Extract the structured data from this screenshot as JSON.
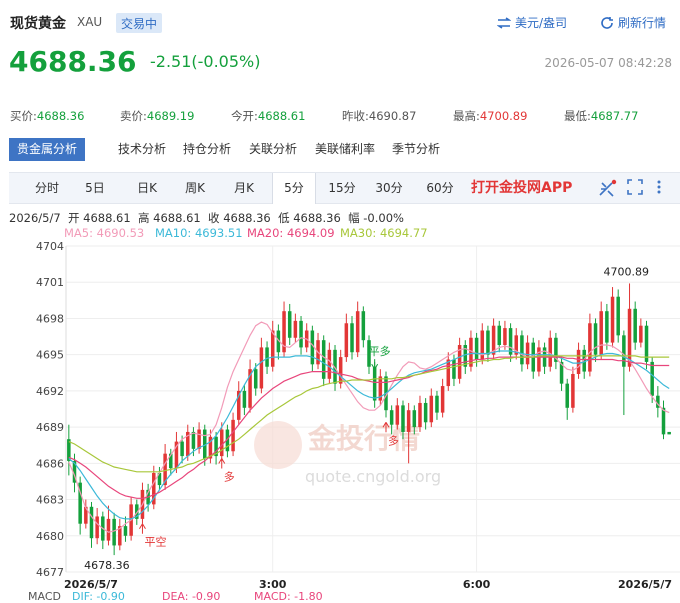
{
  "header": {
    "title": "现货黄金",
    "code": "XAU",
    "status": "交易中",
    "currency_label": "美元/盎司",
    "refresh_label": "刷新行情"
  },
  "quote": {
    "price": "4688.36",
    "change": "-2.51(-0.05%)",
    "time": "2026-05-07 08:42:28",
    "bid_label": "买价:",
    "bid": "4688.36",
    "ask_label": "卖价:",
    "ask": "4689.19",
    "open_label": "今开:",
    "open": "4688.61",
    "prev_close_label": "昨收:",
    "prev_close": "4690.87",
    "high_label": "最高:",
    "high": "4700.89",
    "low_label": "最低:",
    "low": "4687.77"
  },
  "analysis_tabs": [
    "贵金属分析",
    "技术分析",
    "持仓分析",
    "关联分析",
    "美联储利率",
    "季节分析"
  ],
  "period_tabs": [
    "分时",
    "5日",
    "日K",
    "周K",
    "月K",
    "5分",
    "15分",
    "30分",
    "60分"
  ],
  "active_period": "5分",
  "app_link": "打开金投网APP",
  "icons": {
    "currency": "swap-icon",
    "refresh": "refresh-icon",
    "draw": "draw-tool-icon",
    "fullscreen": "fullscreen-icon",
    "more": "more-icon"
  },
  "colors": {
    "up": "#e23636",
    "down": "#14a03c",
    "ma5": "#f29bb8",
    "ma10": "#3cb9d8",
    "ma20": "#e8467c",
    "ma30": "#a8c73a"
  },
  "ohlc_line": {
    "date": "2026/5/7",
    "open_label": "开",
    "open": "4688.61",
    "high_label": "高",
    "high": "4688.61",
    "close_label": "收",
    "close": "4688.36",
    "low_label": "低",
    "low": "4688.36",
    "amp_label": "幅",
    "amp": "-0.00%"
  },
  "ma_legend": [
    {
      "label": "MA5:",
      "value": "4690.53"
    },
    {
      "label": "MA10:",
      "value": "4693.51"
    },
    {
      "label": "MA20:",
      "value": "4694.09"
    },
    {
      "label": "MA30:",
      "value": "4694.77"
    }
  ],
  "macd_legend": [
    "MACD",
    "DIF: -0.90",
    "DEA: -0.90",
    "MACD: -1.80"
  ],
  "watermark": {
    "text": "金投行情",
    "url": "quote.cngold.org"
  },
  "chart_data": {
    "type": "candlestick",
    "ylim": [
      4677,
      4704
    ],
    "yticks": [
      4704,
      4701,
      4698,
      4695,
      4692,
      4689,
      4686,
      4683,
      4680,
      4677
    ],
    "xticks": [
      {
        "label": "2026/5/7",
        "index": 0
      },
      {
        "label": "3:00",
        "index": 36
      },
      {
        "label": "6:00",
        "index": 72
      },
      {
        "label": "2026/5/7",
        "index": 108
      }
    ],
    "annotations": [
      {
        "text": "4678.36",
        "type": "low"
      },
      {
        "text": "4700.89",
        "type": "high"
      },
      {
        "text": "平空",
        "type": "signal"
      },
      {
        "text": "多",
        "type": "signal"
      },
      {
        "text": "平多",
        "type": "signal"
      },
      {
        "text": "多",
        "type": "signal"
      }
    ],
    "series": [
      {
        "name": "MA5",
        "values": [
          4686.1,
          4685.0,
          4683.6,
          4682.3,
          4681.6,
          4681.0,
          4680.6,
          4680.3,
          4680.4,
          4680.6,
          4681.0,
          4681.3,
          4681.9,
          4682.6,
          4683.6,
          4684.4,
          4685.2,
          4686.0,
          4686.7,
          4687.4,
          4688.0,
          4688.3,
          4688.5,
          4688.4,
          4688.3,
          4688.4,
          4689.2,
          4690.6,
          4692.3,
          4693.6,
          4694.6,
          4695.6,
          4696.6,
          4697.4,
          4697.7,
          4697.5,
          4696.8,
          4696.2,
          4695.7,
          4695.6,
          4696.0,
          4696.4,
          4696.3,
          4695.8,
          4695.2,
          4694.8,
          4694.5,
          4693.9,
          4693.2,
          4692.5,
          4691.8,
          4691.1,
          4690.6,
          4690.4,
          4690.4,
          4690.8,
          4691.6,
          4692.5,
          4693.3,
          4694.0,
          4694.4,
          4694.3,
          4693.9,
          4693.8,
          4694.0,
          4694.3,
          4694.6,
          4694.9,
          4695.2,
          4695.4,
          4695.5,
          4695.3,
          4695.1,
          4695.0,
          4695.1,
          4695.3,
          4695.6,
          4695.7,
          4695.6,
          4695.3,
          4695.0,
          4694.8,
          4694.9,
          4695.2,
          4695.3,
          4695.1,
          4694.7,
          4694.2,
          4693.8,
          4693.7,
          4694.0,
          4694.6,
          4695.2,
          4695.6,
          4695.8,
          4695.8,
          4695.7,
          4695.4,
          4695.0,
          4694.5,
          4693.8,
          4693.0,
          4692.2,
          4691.5,
          4690.9,
          4690.4,
          4690.2
        ]
      },
      {
        "name": "MA10",
        "values": [
          4686.4,
          4686.0,
          4685.4,
          4684.7,
          4684.0,
          4683.3,
          4682.7,
          4682.2,
          4681.8,
          4681.5,
          4681.4,
          4681.4,
          4681.6,
          4682.0,
          4682.5,
          4683.1,
          4683.8,
          4684.5,
          4685.1,
          4685.6,
          4686.2,
          4686.6,
          4687.0,
          4687.3,
          4687.5,
          4687.8,
          4688.3,
          4689.0,
          4689.8,
          4690.7,
          4691.6,
          4692.5,
          4693.3,
          4694.0,
          4694.4,
          4694.7,
          4694.8,
          4694.8,
          4694.8,
          4694.8,
          4694.9,
          4694.9,
          4694.9,
          4694.8,
          4694.6,
          4694.3,
          4694.0,
          4693.6,
          4693.2,
          4692.8,
          4692.4,
          4692.0,
          4691.7,
          4691.5,
          4691.4,
          4691.5,
          4691.8,
          4692.2,
          4692.6,
          4693.0,
          4693.3,
          4693.5,
          4693.6,
          4693.7,
          4693.8,
          4694.0,
          4694.2,
          4694.4,
          4694.6,
          4694.8,
          4695.0,
          4695.1,
          4695.1,
          4695.1,
          4695.1,
          4695.2,
          4695.3,
          4695.3,
          4695.3,
          4695.2,
          4695.1,
          4695.0,
          4695.0,
          4695.0,
          4695.0,
          4695.0,
          4694.9,
          4694.7,
          4694.5,
          4694.3,
          4694.3,
          4694.4,
          4694.6,
          4694.8,
          4695.0,
          4695.1,
          4695.1,
          4695.0,
          4694.8,
          4694.6,
          4694.3,
          4694.0,
          4693.7,
          4693.3,
          4692.9,
          4692.5,
          4692.2
        ]
      },
      {
        "name": "MA20",
        "values": [
          4686.5,
          4686.3,
          4686.0,
          4685.7,
          4685.3,
          4684.9,
          4684.5,
          4684.1,
          4683.8,
          4683.5,
          4683.3,
          4683.2,
          4683.1,
          4683.1,
          4683.2,
          4683.4,
          4683.6,
          4683.9,
          4684.2,
          4684.5,
          4684.8,
          4685.2,
          4685.5,
          4685.9,
          4686.2,
          4686.6,
          4687.0,
          4687.5,
          4688.0,
          4688.6,
          4689.2,
          4689.8,
          4690.4,
          4690.9,
          4691.4,
          4691.8,
          4692.2,
          4692.5,
          4692.8,
          4693.0,
          4693.2,
          4693.4,
          4693.5,
          4693.6,
          4693.6,
          4693.6,
          4693.6,
          4693.5,
          4693.4,
          4693.3,
          4693.2,
          4693.0,
          4692.9,
          4692.8,
          4692.7,
          4692.7,
          4692.7,
          4692.8,
          4692.9,
          4693.0,
          4693.1,
          4693.3,
          4693.4,
          4693.6,
          4693.7,
          4693.8,
          4694.0,
          4694.1,
          4694.2,
          4694.3,
          4694.4,
          4694.5,
          4694.6,
          4694.6,
          4694.7,
          4694.7,
          4694.8,
          4694.8,
          4694.8,
          4694.8,
          4694.8,
          4694.8,
          4694.8,
          4694.8,
          4694.8,
          4694.8,
          4694.8,
          4694.8,
          4694.7,
          4694.7,
          4694.6,
          4694.6,
          4694.6,
          4694.6,
          4694.6,
          4694.6,
          4694.6,
          4694.5,
          4694.5,
          4694.4,
          4694.3,
          4694.3,
          4694.2,
          4694.1,
          4694.1,
          4694.1,
          4694.1
        ]
      },
      {
        "name": "MA30",
        "values": [
          4687.8,
          4687.6,
          4687.3,
          4687.0,
          4686.7,
          4686.4,
          4686.1,
          4685.9,
          4685.7,
          4685.6,
          4685.5,
          4685.4,
          4685.3,
          4685.3,
          4685.3,
          4685.3,
          4685.3,
          4685.4,
          4685.5,
          4685.6,
          4685.7,
          4685.9,
          4686.0,
          4686.2,
          4686.4,
          4686.6,
          4686.8,
          4687.1,
          4687.4,
          4687.7,
          4688.0,
          4688.4,
          4688.8,
          4689.2,
          4689.6,
          4690.0,
          4690.3,
          4690.6,
          4690.9,
          4691.2,
          4691.5,
          4691.7,
          4692.0,
          4692.2,
          4692.3,
          4692.5,
          4692.6,
          4692.7,
          4692.8,
          4692.8,
          4692.9,
          4692.9,
          4692.9,
          4692.9,
          4693.0,
          4693.0,
          4693.0,
          4693.0,
          4693.1,
          4693.1,
          4693.2,
          4693.3,
          4693.4,
          4693.5,
          4693.6,
          4693.7,
          4693.8,
          4693.9,
          4694.0,
          4694.1,
          4694.2,
          4694.3,
          4694.4,
          4694.5,
          4694.5,
          4694.6,
          4694.6,
          4694.7,
          4694.7,
          4694.8,
          4694.8,
          4694.8,
          4694.8,
          4694.9,
          4694.9,
          4694.9,
          4694.9,
          4694.9,
          4694.9,
          4694.9,
          4694.9,
          4694.9,
          4694.9,
          4694.9,
          4694.9,
          4694.9,
          4694.9,
          4694.9,
          4694.9,
          4694.9,
          4694.9,
          4694.8,
          4694.8,
          4694.8,
          4694.8,
          4694.8,
          4694.8
        ]
      }
    ],
    "candles": [
      [
        4688.0,
        4686.2,
        4689.2,
        4685.0
      ],
      [
        4686.2,
        4684.4,
        4686.8,
        4683.6
      ],
      [
        4684.4,
        4681.0,
        4684.9,
        4680.1
      ],
      [
        4681.0,
        4682.4,
        4683.0,
        4680.6
      ],
      [
        4682.4,
        4679.8,
        4682.8,
        4679.0
      ],
      [
        4679.8,
        4681.6,
        4682.3,
        4679.3
      ],
      [
        4681.6,
        4679.6,
        4682.0,
        4678.9
      ],
      [
        4679.6,
        4681.4,
        4682.5,
        4679.2
      ],
      [
        4681.4,
        4679.2,
        4681.9,
        4678.4
      ],
      [
        4679.2,
        4680.8,
        4681.4,
        4678.8
      ],
      [
        4680.8,
        4680.0,
        4681.6,
        4679.5
      ],
      [
        4680.0,
        4682.6,
        4683.2,
        4679.6
      ],
      [
        4682.6,
        4681.4,
        4683.0,
        4680.9
      ],
      [
        4681.4,
        4683.8,
        4684.4,
        4681.0
      ],
      [
        4683.8,
        4682.6,
        4684.3,
        4682.0
      ],
      [
        4682.6,
        4685.2,
        4685.8,
        4682.2
      ],
      [
        4685.2,
        4684.2,
        4685.7,
        4683.8
      ],
      [
        4684.2,
        4686.8,
        4687.6,
        4683.8
      ],
      [
        4686.8,
        4685.6,
        4687.2,
        4685.0
      ],
      [
        4685.6,
        4687.8,
        4688.6,
        4685.2
      ],
      [
        4687.8,
        4686.6,
        4688.3,
        4686.0
      ],
      [
        4686.6,
        4688.6,
        4689.2,
        4686.2
      ],
      [
        4688.6,
        4687.2,
        4689.0,
        4686.6
      ],
      [
        4687.2,
        4688.8,
        4689.4,
        4686.8
      ],
      [
        4688.8,
        4686.4,
        4689.2,
        4685.8
      ],
      [
        4686.4,
        4688.2,
        4688.8,
        4686.0
      ],
      [
        4688.2,
        4686.6,
        4688.6,
        4685.9
      ],
      [
        4686.6,
        4688.8,
        4689.4,
        4686.2
      ],
      [
        4688.8,
        4687.0,
        4689.2,
        4686.5
      ],
      [
        4687.0,
        4689.6,
        4690.2,
        4686.6
      ],
      [
        4689.6,
        4692.0,
        4692.8,
        4689.2
      ],
      [
        4692.0,
        4690.6,
        4692.5,
        4690.0
      ],
      [
        4690.6,
        4693.8,
        4694.6,
        4690.2
      ],
      [
        4693.8,
        4692.2,
        4694.3,
        4691.6
      ],
      [
        4692.2,
        4695.6,
        4696.4,
        4691.8
      ],
      [
        4695.6,
        4694.0,
        4696.1,
        4693.4
      ],
      [
        4694.0,
        4697.0,
        4697.8,
        4693.6
      ],
      [
        4697.0,
        4695.2,
        4697.5,
        4694.6
      ],
      [
        4695.2,
        4698.6,
        4699.4,
        4694.8
      ],
      [
        4698.6,
        4696.4,
        4699.2,
        4695.8
      ],
      [
        4696.4,
        4697.8,
        4698.4,
        4696.0
      ],
      [
        4697.8,
        4695.6,
        4698.2,
        4695.0
      ],
      [
        4695.6,
        4697.0,
        4697.6,
        4695.2
      ],
      [
        4697.0,
        4694.2,
        4697.4,
        4693.6
      ],
      [
        4694.2,
        4696.2,
        4696.8,
        4693.8
      ],
      [
        4696.2,
        4693.0,
        4696.6,
        4692.4
      ],
      [
        4693.0,
        4695.4,
        4696.0,
        4692.6
      ],
      [
        4695.4,
        4692.6,
        4695.8,
        4692.0
      ],
      [
        4692.6,
        4694.8,
        4695.4,
        4692.2
      ],
      [
        4694.8,
        4697.6,
        4698.4,
        4694.4
      ],
      [
        4697.6,
        4695.2,
        4698.2,
        4694.6
      ],
      [
        4695.2,
        4698.6,
        4699.4,
        4694.8
      ],
      [
        4698.6,
        4696.2,
        4699.0,
        4695.6
      ],
      [
        4696.2,
        4694.0,
        4696.6,
        4693.4
      ],
      [
        4694.0,
        4691.2,
        4694.4,
        4690.6
      ],
      [
        4691.2,
        4693.2,
        4693.8,
        4690.8
      ],
      [
        4693.2,
        4690.4,
        4693.6,
        4689.8
      ],
      [
        4690.4,
        4689.2,
        4690.8,
        4688.4
      ],
      [
        4689.2,
        4690.8,
        4691.4,
        4688.8
      ],
      [
        4690.8,
        4688.6,
        4691.2,
        4688.0
      ],
      [
        4688.6,
        4690.4,
        4691.0,
        4686.0
      ],
      [
        4690.4,
        4689.0,
        4690.8,
        4688.4
      ],
      [
        4689.0,
        4691.0,
        4691.6,
        4688.6
      ],
      [
        4691.0,
        4689.4,
        4691.4,
        4688.8
      ],
      [
        4689.4,
        4691.6,
        4692.2,
        4689.0
      ],
      [
        4691.6,
        4690.2,
        4692.0,
        4689.6
      ],
      [
        4690.2,
        4692.4,
        4693.0,
        4689.8
      ],
      [
        4692.4,
        4694.6,
        4695.2,
        4692.0
      ],
      [
        4694.6,
        4693.0,
        4695.0,
        4692.4
      ],
      [
        4693.0,
        4695.8,
        4696.4,
        4692.6
      ],
      [
        4695.8,
        4694.0,
        4696.2,
        4693.4
      ],
      [
        4694.0,
        4696.4,
        4697.0,
        4693.6
      ],
      [
        4696.4,
        4694.6,
        4696.8,
        4694.0
      ],
      [
        4694.6,
        4697.0,
        4697.6,
        4694.2
      ],
      [
        4697.0,
        4695.0,
        4697.4,
        4694.4
      ],
      [
        4695.0,
        4697.4,
        4698.0,
        4694.6
      ],
      [
        4697.4,
        4695.8,
        4697.8,
        4695.2
      ],
      [
        4695.8,
        4697.2,
        4697.8,
        4695.4
      ],
      [
        4697.2,
        4695.0,
        4697.6,
        4694.4
      ],
      [
        4695.0,
        4696.6,
        4697.2,
        4694.6
      ],
      [
        4696.6,
        4694.2,
        4697.0,
        4693.6
      ],
      [
        4694.2,
        4696.0,
        4696.6,
        4693.8
      ],
      [
        4696.0,
        4693.6,
        4696.4,
        4693.0
      ],
      [
        4693.6,
        4695.6,
        4696.2,
        4693.2
      ],
      [
        4695.6,
        4694.0,
        4696.0,
        4693.4
      ],
      [
        4694.0,
        4696.4,
        4697.0,
        4693.6
      ],
      [
        4696.4,
        4694.4,
        4696.8,
        4693.8
      ],
      [
        4694.4,
        4692.6,
        4694.8,
        4692.0
      ],
      [
        4692.6,
        4690.6,
        4693.0,
        4689.6
      ],
      [
        4690.6,
        4693.4,
        4694.0,
        4690.2
      ],
      [
        4693.4,
        4695.4,
        4696.0,
        4693.0
      ],
      [
        4695.4,
        4693.6,
        4695.8,
        4693.0
      ],
      [
        4693.6,
        4697.6,
        4698.4,
        4693.2
      ],
      [
        4697.6,
        4695.0,
        4698.0,
        4694.4
      ],
      [
        4695.0,
        4698.6,
        4699.4,
        4694.6
      ],
      [
        4698.6,
        4696.0,
        4699.2,
        4695.4
      ],
      [
        4696.0,
        4699.8,
        4700.6,
        4695.6
      ],
      [
        4699.8,
        4696.6,
        4700.4,
        4696.0
      ],
      [
        4696.6,
        4694.0,
        4697.0,
        4690.0
      ],
      [
        4694.0,
        4698.8,
        4700.9,
        4693.6
      ],
      [
        4698.8,
        4696.0,
        4699.4,
        4695.4
      ],
      [
        4696.0,
        4697.4,
        4698.0,
        4695.6
      ],
      [
        4697.4,
        4694.4,
        4697.8,
        4693.8
      ],
      [
        4694.4,
        4691.6,
        4694.8,
        4691.0
      ],
      [
        4691.6,
        4690.6,
        4692.4,
        4689.8
      ],
      [
        4690.6,
        4688.4,
        4691.2,
        4688.0
      ],
      [
        4688.6,
        4688.4,
        4688.6,
        4688.4
      ]
    ]
  }
}
